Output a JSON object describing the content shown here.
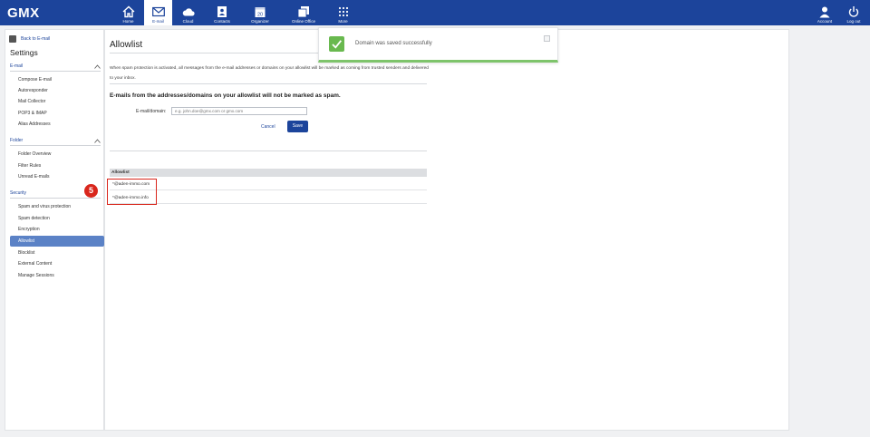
{
  "app": {
    "logo": "GMX"
  },
  "nav": {
    "items": [
      {
        "label": "Home",
        "icon": "home-icon"
      },
      {
        "label": "E-mail",
        "icon": "mail-icon",
        "active": true
      },
      {
        "label": "Cloud",
        "icon": "cloud-icon"
      },
      {
        "label": "Contacts",
        "icon": "contacts-icon"
      },
      {
        "label": "Organizer",
        "icon": "calendar-icon",
        "day": "20"
      },
      {
        "label": "Online Office",
        "icon": "office-icon"
      },
      {
        "label": "More",
        "icon": "grid-icon"
      }
    ],
    "account_label": "Account",
    "logout_label": "Log out"
  },
  "sidebar": {
    "back_label": "Back to E-mail",
    "title": "Settings",
    "sections": [
      {
        "label": "E-mail",
        "items": [
          "Compose E-mail",
          "Autoresponder",
          "Mail Collector",
          "POP3 & IMAP",
          "Alias Addresses"
        ]
      },
      {
        "label": "Folder",
        "items": [
          "Folder Overview",
          "Filter Rules",
          "Unread E-mails"
        ]
      },
      {
        "label": "Security",
        "items": [
          "Spam and virus protection",
          "Spam detection",
          "Encryption",
          "Allowlist",
          "Blocklist",
          "External Content",
          "Manage Sessions"
        ]
      }
    ],
    "active_item": "Allowlist"
  },
  "annotation": {
    "badge": "5"
  },
  "main": {
    "title": "Allowlist",
    "description": "When spam protection is activated, all messages from the e-mail addresses or domains on your allowlist will be marked as coming from trusted senders and delivered to your inbox.",
    "subheading": "E-mails from the addresses/domains on your allowlist will not be marked as spam.",
    "field_label": "E-mail/domain:",
    "field_placeholder": "e.g. john.doe@gmx.com or gmx.com",
    "field_value": "",
    "cancel_label": "Cancel",
    "save_label": "Save",
    "list_header": "Allowlist",
    "entries": [
      "*@aden-immo.com",
      "*@aden-immo.info"
    ]
  },
  "toast": {
    "message": "Domain was saved successfully"
  },
  "colors": {
    "brand": "#1c449b",
    "active": "#5b82c6",
    "success": "#69b94f",
    "alert": "#d9261c"
  }
}
